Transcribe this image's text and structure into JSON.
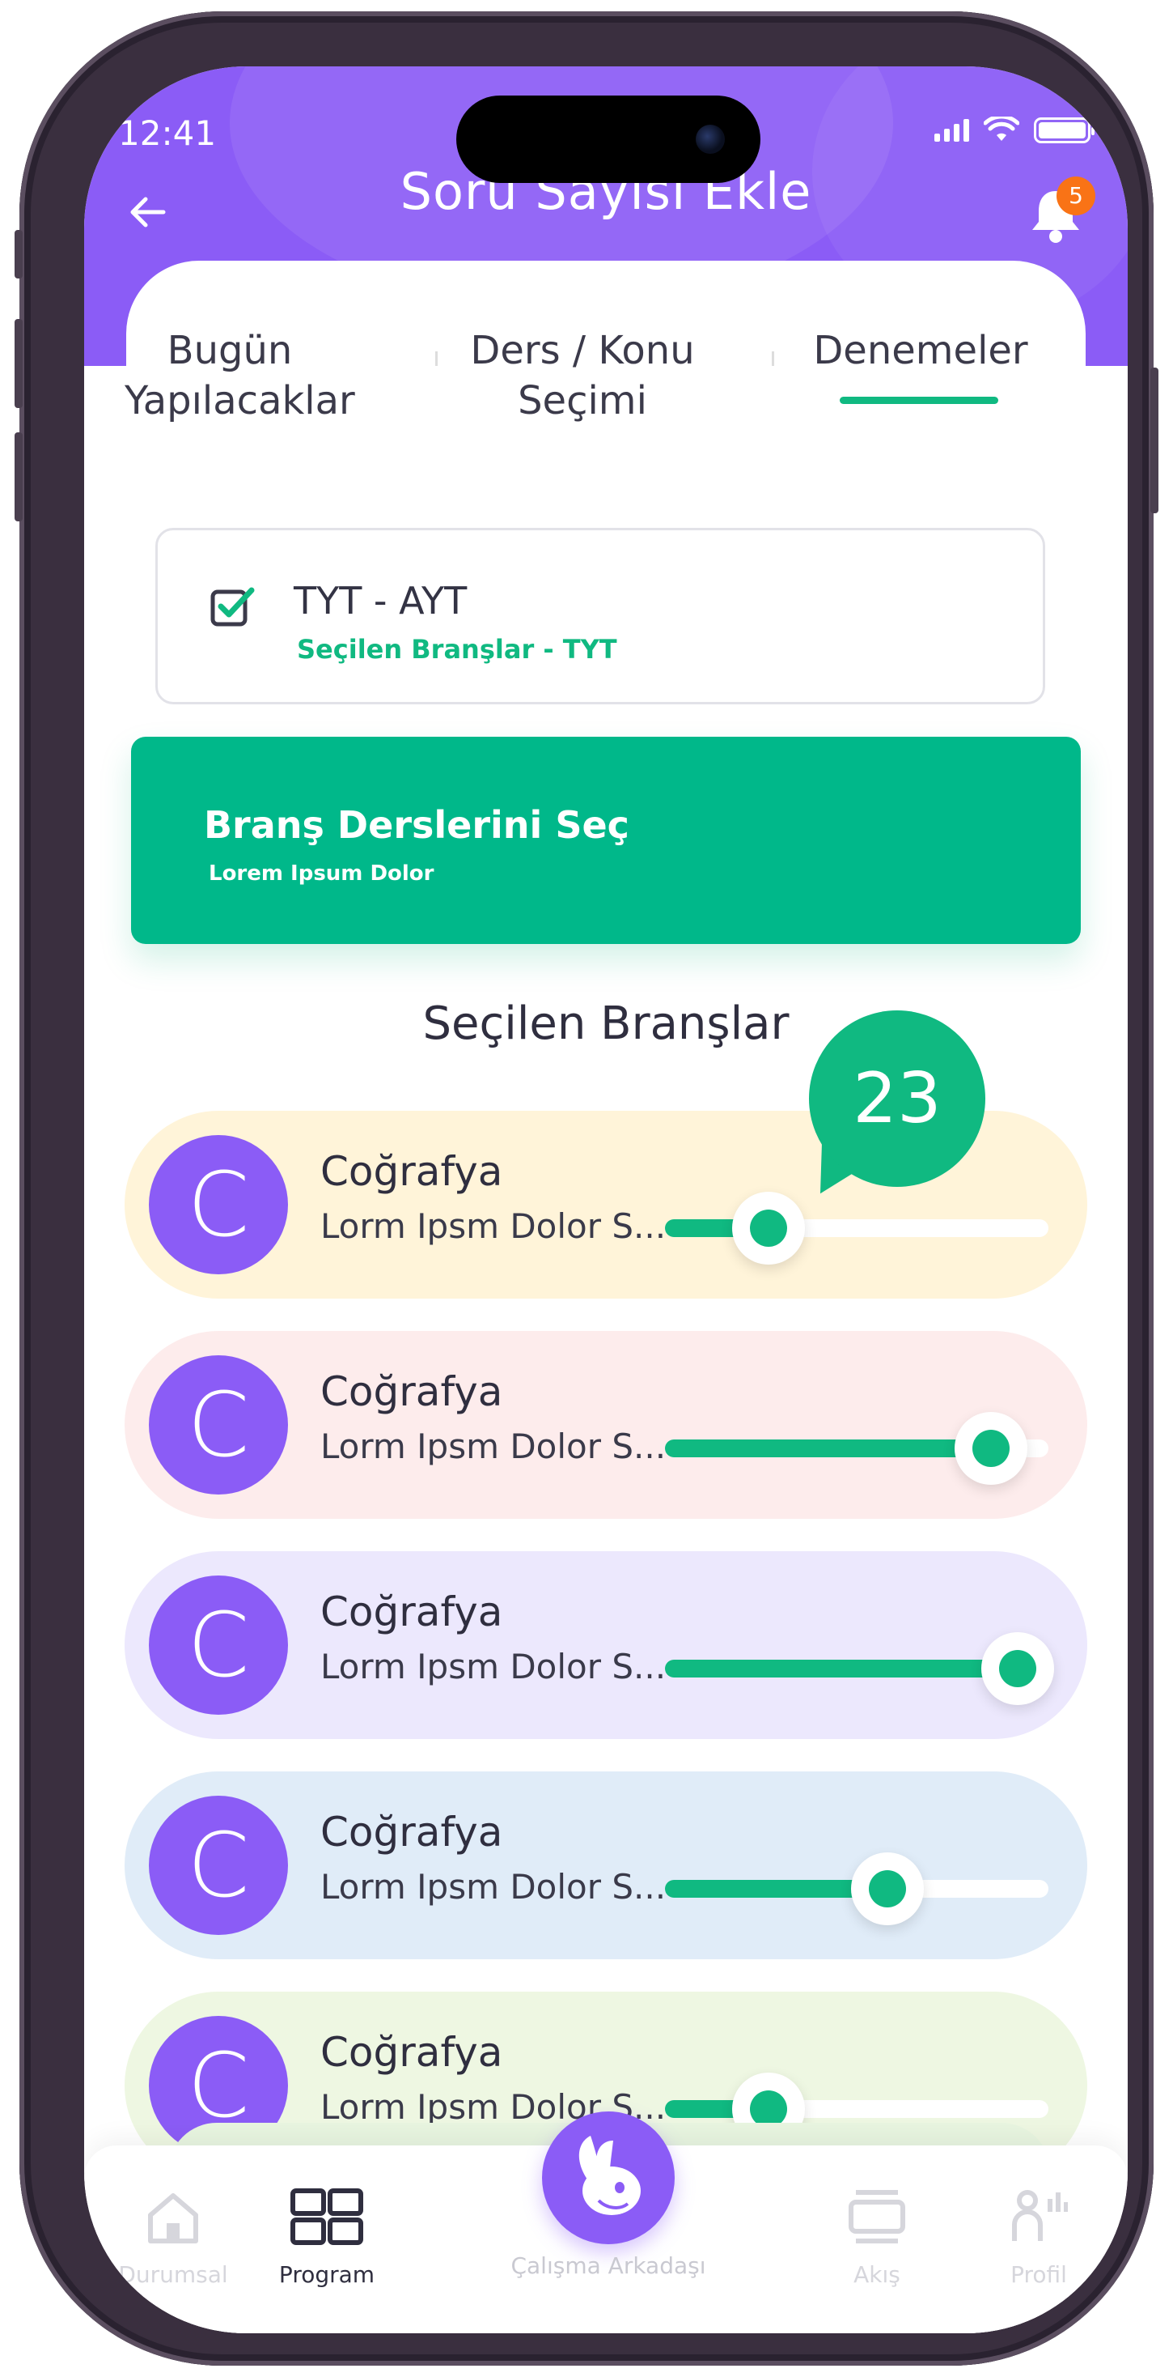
{
  "status_bar": {
    "time": "12:41"
  },
  "header": {
    "title": "Soru Sayısı Ekle",
    "notification_count": "5"
  },
  "tabs": [
    {
      "line1": "Bugün",
      "line2": "Yapılacaklar"
    },
    {
      "line1": "Ders / Konu",
      "line2": "Seçimi"
    },
    {
      "line1": "Denemeler",
      "line2": ""
    }
  ],
  "active_tab": "Denemeler",
  "exam_select": {
    "title": "TYT - AYT",
    "subtitle": "Seçilen Branşlar - TYT",
    "checked": true
  },
  "branch_button": {
    "title": "Branş Derslerini Seç",
    "subtitle": "Lorem Ipsum Dolor"
  },
  "selected_section": {
    "title": "Seçilen Branşlar",
    "value_bubble": "23",
    "rows": [
      {
        "initial": "C",
        "name": "Coğrafya",
        "description": "Lorm Ipsm Dolor S...",
        "level": 0.27,
        "bg": "#fff4d9"
      },
      {
        "initial": "C",
        "name": "Coğrafya",
        "description": "Lorm Ipsm Dolor S...",
        "level": 0.85,
        "bg": "#fdecec"
      },
      {
        "initial": "C",
        "name": "Coğrafya",
        "description": "Lorm Ipsm Dolor S...",
        "level": 0.92,
        "bg": "#ece8fd"
      },
      {
        "initial": "C",
        "name": "Coğrafya",
        "description": "Lorm Ipsm Dolor S...",
        "level": 0.58,
        "bg": "#e0ecf8"
      },
      {
        "initial": "C",
        "name": "Coğrafya",
        "description": "Lorm Ipsm Dolor S...",
        "level": 0.27,
        "bg": "#eef7e2"
      }
    ]
  },
  "bottom_nav": {
    "items": [
      {
        "label": "Durumsal",
        "icon": "home-icon",
        "active": false
      },
      {
        "label": "Program",
        "icon": "grid-icon",
        "active": true
      },
      {
        "label": "Çalışma Arkadaşı",
        "icon": "rabbit-icon",
        "active": false
      },
      {
        "label": "Akış",
        "icon": "feed-icon",
        "active": false
      },
      {
        "label": "Profil",
        "icon": "profile-icon",
        "active": false
      }
    ]
  },
  "colors": {
    "primary": "#8b5cf6",
    "accent": "#10b981",
    "badge": "#f97316"
  }
}
